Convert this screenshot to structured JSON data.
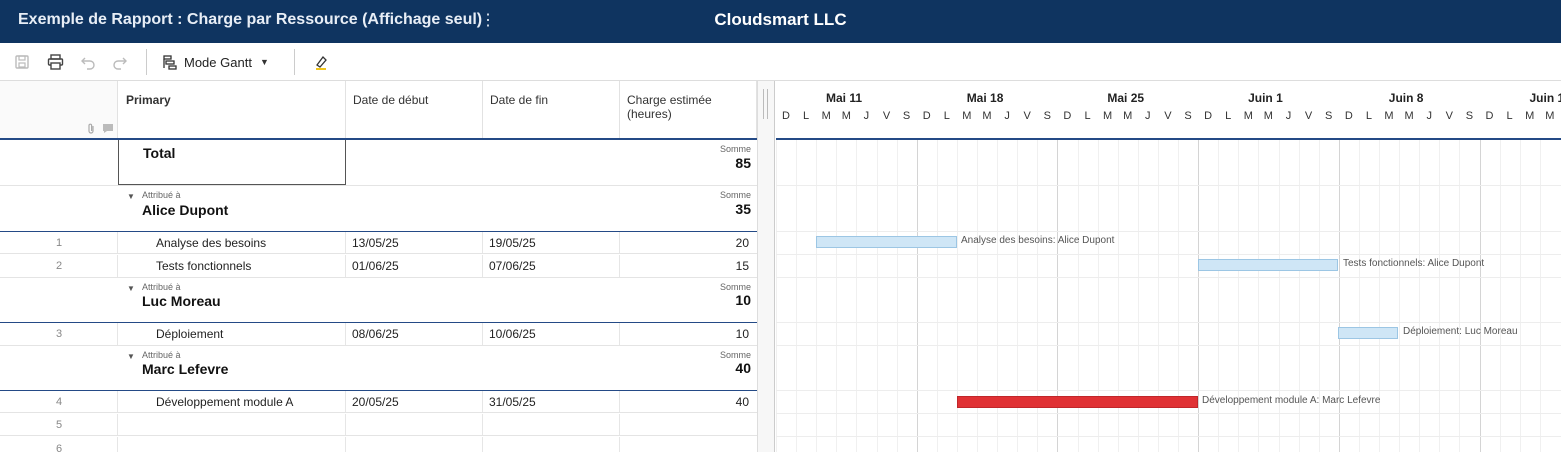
{
  "header": {
    "report_title": "Exemple de Rapport : Charge par Ressource (Affichage seul)",
    "menu_glyph": "⋮",
    "company": "Cloudsmart LLC"
  },
  "toolbar": {
    "save_icon": "save-icon",
    "print_icon": "print-icon",
    "undo_icon": "undo-icon",
    "redo_icon": "redo-icon",
    "view_mode_label": "Mode Gantt",
    "highlight_icon": "highlighter-icon"
  },
  "columns": {
    "primary": "Primary",
    "start": "Date de début",
    "end": "Date de fin",
    "effort_line1": "Charge estimée",
    "effort_line2": "(heures)"
  },
  "total": {
    "label": "Total",
    "sum_label": "Somme",
    "sum_value": "85"
  },
  "groups": [
    {
      "sub_label": "Attribué à",
      "name": "Alice Dupont",
      "sum_label": "Somme",
      "sum_value": "35",
      "rows": [
        {
          "num": "1",
          "task": "Analyse des besoins",
          "start": "13/05/25",
          "end": "19/05/25",
          "hours": "20",
          "bar_label": "Analyse des besoins: Alice Dupont"
        },
        {
          "num": "2",
          "task": "Tests fonctionnels",
          "start": "01/06/25",
          "end": "07/06/25",
          "hours": "15",
          "bar_label": "Tests fonctionnels: Alice Dupont"
        }
      ]
    },
    {
      "sub_label": "Attribué à",
      "name": "Luc Moreau",
      "sum_label": "Somme",
      "sum_value": "10",
      "rows": [
        {
          "num": "3",
          "task": "Déploiement",
          "start": "08/06/25",
          "end": "10/06/25",
          "hours": "10",
          "bar_label": "Déploiement: Luc Moreau"
        }
      ]
    },
    {
      "sub_label": "Attribué à",
      "name": "Marc Lefevre",
      "sum_label": "Somme",
      "sum_value": "40",
      "rows": [
        {
          "num": "4",
          "task": "Développement module A",
          "start": "20/05/25",
          "end": "31/05/25",
          "hours": "40",
          "bar_label": "Développement module A: Marc Lefevre"
        }
      ]
    }
  ],
  "empty_rows": [
    "5",
    "6"
  ],
  "timeline": {
    "weeks": [
      "Mai 11",
      "Mai 18",
      "Mai 25",
      "Juin 1",
      "Juin 8",
      "Juin 1"
    ],
    "days": [
      "D",
      "L",
      "M",
      "M",
      "J",
      "V",
      "S",
      "D",
      "L",
      "M",
      "M",
      "J",
      "V",
      "S",
      "D",
      "L",
      "M",
      "M",
      "J",
      "V",
      "S",
      "D",
      "L",
      "M",
      "M",
      "J",
      "V",
      "S",
      "D",
      "L",
      "M",
      "M",
      "J",
      "V",
      "S",
      "D",
      "L",
      "M",
      "M"
    ],
    "bar_colors": {
      "default": "#cfe6f6",
      "critical": "#e03134"
    }
  }
}
